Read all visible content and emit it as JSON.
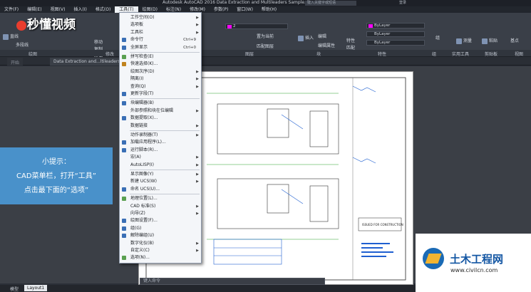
{
  "app": {
    "title": "Autodesk AutoCAD 2016   Data Extraction and Multileaders Sample.dwg",
    "search_placeholder": "键入关键字或短语",
    "login": "登录"
  },
  "menubar": {
    "items": [
      "文件(F)",
      "编辑(E)",
      "视图(V)",
      "插入(I)",
      "格式(O)",
      "工具(T)",
      "绘图(D)",
      "标注(N)",
      "修改(M)",
      "参数(P)",
      "窗口(W)",
      "帮助(H)"
    ],
    "active_index": 5
  },
  "ribbon": {
    "buttons": [
      "直线",
      "多段线",
      "移动",
      "复制",
      "拉伸",
      "插入",
      "编辑",
      "编辑属性",
      "特性",
      "匹配",
      "组",
      "测量",
      "粘贴",
      "基点"
    ],
    "layer_combo": "2",
    "layer_buttons": [
      "置为当前",
      "匹配图层"
    ],
    "props": [
      "ByLayer",
      "ByLayer",
      "ByLayer"
    ],
    "panel_labels": [
      "绘图",
      "修改",
      "图层",
      "块",
      "特性",
      "组",
      "实用工具",
      "剪贴板",
      "视图"
    ]
  },
  "watermark": {
    "brand": "秒懂视频"
  },
  "tabs": [
    "开始",
    "Data Extraction and...ltileaders S"
  ],
  "tip": {
    "heading": "小提示：",
    "line1": "CAD菜单栏，打开“工具”",
    "line2": "点击最下面的“选项”"
  },
  "tools_menu": {
    "items": [
      {
        "label": "工作空间(O)",
        "shortcut": "",
        "submenu": true,
        "icon": ""
      },
      {
        "label": "选项板",
        "shortcut": "",
        "submenu": true,
        "icon": ""
      },
      {
        "label": "工具栏",
        "shortcut": "",
        "submenu": true,
        "icon": ""
      },
      {
        "label": "命令行",
        "shortcut": "Ctrl+9",
        "submenu": false,
        "icon": "#3a6fb5"
      },
      {
        "label": "全屏显示",
        "shortcut": "Ctrl+0",
        "submenu": false,
        "icon": "#3a6fb5"
      },
      {
        "label": "拼写检查(E)",
        "shortcut": "",
        "submenu": false,
        "icon": "#5aa050"
      },
      {
        "label": "快速选择(K)...",
        "shortcut": "",
        "submenu": false,
        "icon": "#c0831e"
      },
      {
        "label": "绘图次序(D)",
        "shortcut": "",
        "submenu": true,
        "icon": ""
      },
      {
        "label": "隔离(I)",
        "shortcut": "",
        "submenu": true,
        "icon": ""
      },
      {
        "label": "查询(Q)",
        "shortcut": "",
        "submenu": true,
        "icon": ""
      },
      {
        "label": "更新字段(T)",
        "shortcut": "",
        "submenu": false,
        "icon": "#3a6fb5"
      },
      {
        "label": "块编辑器(B)",
        "shortcut": "",
        "submenu": false,
        "icon": "#3a6fb5"
      },
      {
        "label": "外部参照和块在位编辑",
        "shortcut": "",
        "submenu": true,
        "icon": ""
      },
      {
        "label": "数据提取(X)...",
        "shortcut": "",
        "submenu": false,
        "icon": "#3a6fb5"
      },
      {
        "label": "数据链接",
        "shortcut": "",
        "submenu": true,
        "icon": ""
      },
      {
        "label": "动作录制器(T)",
        "shortcut": "",
        "submenu": true,
        "icon": ""
      },
      {
        "label": "加载应用程序(L)...",
        "shortcut": "",
        "submenu": false,
        "icon": "#3a6fb5"
      },
      {
        "label": "运行脚本(R)...",
        "shortcut": "",
        "submenu": false,
        "icon": "#3a6fb5"
      },
      {
        "label": "宏(A)",
        "shortcut": "",
        "submenu": true,
        "icon": ""
      },
      {
        "label": "AutoLISP(I)",
        "shortcut": "",
        "submenu": true,
        "icon": ""
      },
      {
        "label": "显示图像(Y)",
        "shortcut": "",
        "submenu": true,
        "icon": ""
      },
      {
        "label": "新建 UCS(W)",
        "shortcut": "",
        "submenu": true,
        "icon": ""
      },
      {
        "label": "命名 UCS(U)...",
        "shortcut": "",
        "submenu": false,
        "icon": "#3a6fb5"
      },
      {
        "label": "地理位置(L)...",
        "shortcut": "",
        "submenu": false,
        "icon": "#5aa050"
      },
      {
        "label": "CAD 标准(S)",
        "shortcut": "",
        "submenu": true,
        "icon": ""
      },
      {
        "label": "向导(Z)",
        "shortcut": "",
        "submenu": true,
        "icon": ""
      },
      {
        "label": "绘图设置(F)...",
        "shortcut": "",
        "submenu": false,
        "icon": "#3a6fb5"
      },
      {
        "label": "组(G)",
        "shortcut": "",
        "submenu": false,
        "icon": "#3a6fb5"
      },
      {
        "label": "解除编组(U)",
        "shortcut": "",
        "submenu": false,
        "icon": "#3a6fb5"
      },
      {
        "label": "数字化仪(B)",
        "shortcut": "",
        "submenu": true,
        "icon": ""
      },
      {
        "label": "自定义(C)",
        "shortcut": "",
        "submenu": true,
        "icon": ""
      },
      {
        "label": "选项(N)...",
        "shortcut": "",
        "submenu": false,
        "icon": "#5aa050"
      }
    ]
  },
  "drawing": {
    "labels": [
      "ISSUED FOR CONSTRUCTION"
    ]
  },
  "command_line": {
    "placeholder": "键入命令"
  },
  "status": {
    "model": "模型",
    "layout": "Layout1"
  },
  "logo": {
    "name": "土木工程网",
    "url": "www.civilcn.com"
  },
  "colors": {
    "accent": "#4ca0e2",
    "layer_color": "#ff00ff",
    "logo_blue": "#1356a3"
  }
}
